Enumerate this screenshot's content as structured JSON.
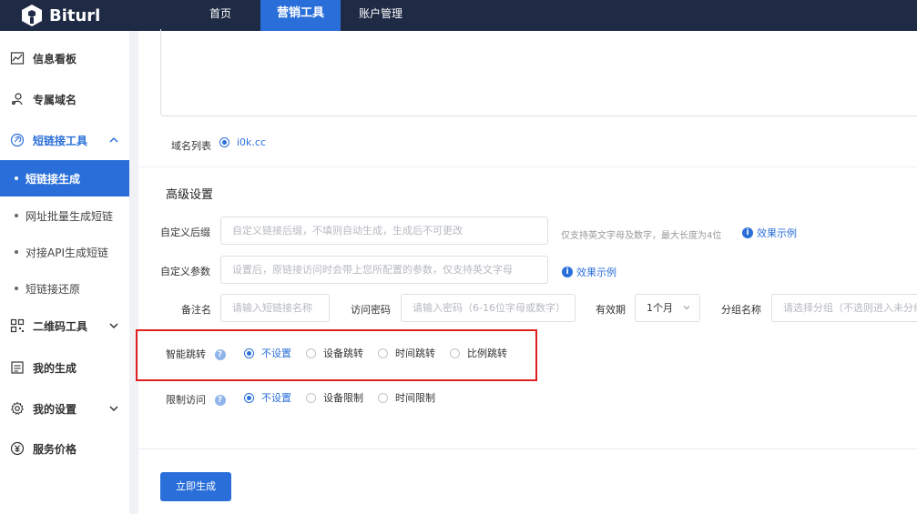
{
  "app": {
    "logo_text": "Biturl"
  },
  "topnav": {
    "home": "首页",
    "tools": "营销工具",
    "account": "账户管理"
  },
  "sidebar": {
    "items": [
      {
        "label": "信息看板",
        "icon": "chart-icon"
      },
      {
        "label": "专属域名",
        "icon": "user-key-icon"
      },
      {
        "label": "短链接工具",
        "icon": "link-icon"
      },
      {
        "label": "二维码工具",
        "icon": "qrcode-icon"
      },
      {
        "label": "我的生成",
        "icon": "list-icon"
      },
      {
        "label": "我的设置",
        "icon": "gear-icon"
      },
      {
        "label": "服务价格",
        "icon": "yen-icon"
      }
    ],
    "subitems": [
      {
        "label": "短链接生成"
      },
      {
        "label": "网址批量生成短链"
      },
      {
        "label": "对接API生成短链"
      },
      {
        "label": "短链接还原"
      }
    ]
  },
  "form": {
    "domain_label": "域名列表",
    "domain_value": "i0k.cc",
    "advanced_title": "高级设置",
    "suffix_label": "自定义后缀",
    "suffix_placeholder": "自定义链接后缀，不填则自动生成，生成后不可更改",
    "suffix_hint": "仅支持英文字母及数字，最大长度为4位",
    "example_link": "效果示例",
    "params_label": "自定义参数",
    "params_placeholder": "设置后，原链接访问时会带上您所配置的参数，仅支持英文字母",
    "remark_label": "备注名",
    "remark_placeholder": "请输入短链接名称",
    "password_label": "访问密码",
    "password_placeholder": "请输入密码（6-16位字母或数字）",
    "validity_label": "有效期",
    "validity_value": "1个月",
    "group_label": "分组名称",
    "group_placeholder": "请选择分组（不选则进入未分组）",
    "smart_label": "智能跳转",
    "smart_options": [
      "不设置",
      "设备跳转",
      "时间跳转",
      "比例跳转"
    ],
    "restrict_label": "限制访问",
    "restrict_options": [
      "不设置",
      "设备限制",
      "时间限制"
    ],
    "submit_label": "立即生成"
  },
  "colors": {
    "primary": "#2a6fd9",
    "topbar": "#1f2a44",
    "highlight": "#e02020"
  }
}
